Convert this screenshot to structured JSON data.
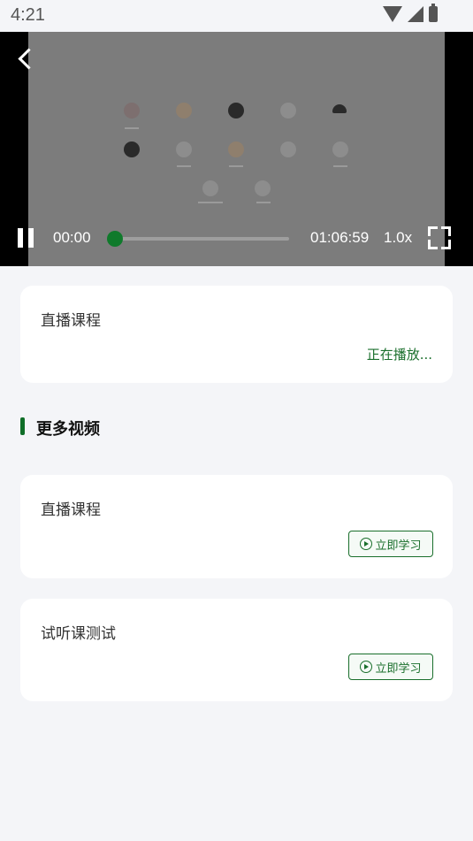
{
  "status": {
    "time": "4:21"
  },
  "player": {
    "current_time": "00:00",
    "total_time": "01:06:59",
    "speed": "1.0x",
    "progress": 0.0,
    "accent": "#0f7a2b"
  },
  "current_course": {
    "title": "直播课程",
    "status": "正在播放..."
  },
  "section": {
    "title": "更多视频"
  },
  "videos": [
    {
      "title": "直播课程",
      "button": "立即学习"
    },
    {
      "title": "试听课测试",
      "button": "立即学习"
    }
  ]
}
